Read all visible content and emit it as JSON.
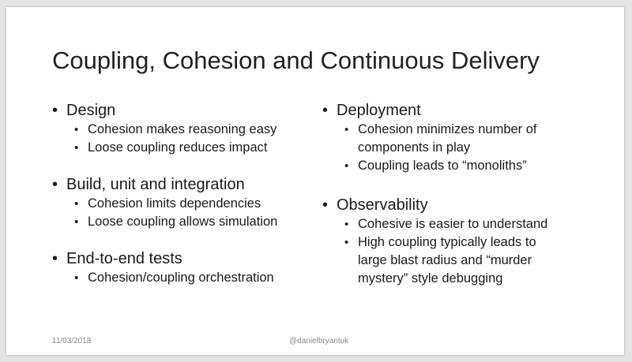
{
  "slide": {
    "title": "Coupling, Cohesion and Continuous Delivery",
    "left_column": [
      {
        "heading": "Design",
        "items": [
          "Cohesion makes reasoning easy",
          "Loose coupling reduces impact"
        ]
      },
      {
        "heading": "Build, unit and integration",
        "items": [
          "Cohesion limits dependencies",
          "Loose coupling allows simulation"
        ]
      },
      {
        "heading": "End-to-end tests",
        "items": [
          "Cohesion/coupling orchestration"
        ]
      }
    ],
    "right_column": [
      {
        "heading": "Deployment",
        "items": [
          "Cohesion minimizes number of components in play",
          "Coupling leads to “monoliths”"
        ]
      },
      {
        "heading": "Observability",
        "items": [
          "Cohesive is easier to understand",
          "High coupling typically leads to large blast radius and “murder mystery” style debugging"
        ]
      }
    ],
    "footer": {
      "date": "11/03/2018",
      "handle": "@danielbryantuk"
    }
  }
}
